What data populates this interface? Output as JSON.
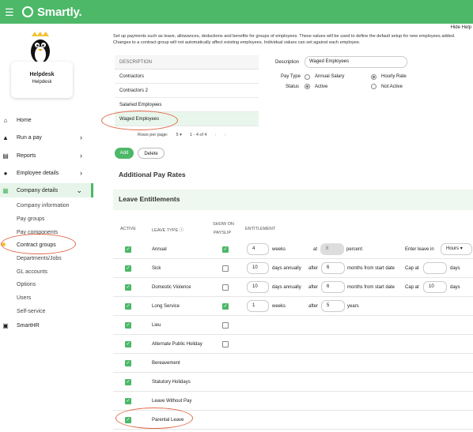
{
  "app": {
    "name": "Smartly."
  },
  "sidebar": {
    "profile": {
      "name": "Helpdesk",
      "role": "Helpdesk"
    },
    "items": [
      {
        "label": "Home",
        "icon": "home-icon"
      },
      {
        "label": "Run a pay",
        "icon": "pay-icon"
      },
      {
        "label": "Reports",
        "icon": "report-icon"
      },
      {
        "label": "Employee details",
        "icon": "person-icon"
      },
      {
        "label": "Company details",
        "icon": "building-icon"
      }
    ],
    "sub": [
      "Company information",
      "Pay groups",
      "Pay components",
      "Contract groups",
      "Departments/Jobs",
      "GL accounts",
      "Options",
      "Users",
      "Self-service"
    ],
    "smarthr": "SmartHR"
  },
  "main": {
    "hide_help": "Hide Help",
    "help_text": "Set up payments such as leave, allowances, deductions and benefits for groups of employees. These values will be used to define the default setup for new employees added. Changes to a contract group will not automatically affect existing employees. Individual values can set against each employee.",
    "table": {
      "header": "DESCRIPTION",
      "rows": [
        "Contractors",
        "Contractors 2",
        "Salaried Employees",
        "Waged Employees"
      ]
    },
    "pagination": {
      "rows_label": "Rows per page:",
      "rows_value": "5",
      "range": "1 - 4 of 4"
    },
    "buttons": {
      "add": "Add",
      "delete": "Delete"
    },
    "form": {
      "description_label": "Description",
      "description_value": "Waged Employees",
      "pay_type_label": "Pay Type",
      "annual_salary": "Annual Salary",
      "hourly_rate": "Hourly Rate",
      "status_label": "Status",
      "active": "Active",
      "not_active": "Not Active"
    },
    "additional_pay_rates": "Additional Pay Rates",
    "leave_entitlements": "Leave Entitlements",
    "leave_columns": {
      "active": "ACTIVE",
      "leave_type": "LEAVE TYPE",
      "show_on": "SHOW ON",
      "payslip": "PAYSLIP",
      "entitlement": "ENTITLEMENT"
    },
    "leave_rows": [
      {
        "name": "Annual",
        "active": true,
        "payslip": true,
        "value": "4",
        "unit": "weeks",
        "at": "at",
        "pct": "8",
        "pct_label": "percent",
        "enter_label": "Enter leave in",
        "enter_value": "Hours"
      },
      {
        "name": "Sick",
        "active": true,
        "payslip": false,
        "value": "10",
        "unit": "days annually",
        "after": "after",
        "after_val": "6",
        "after_unit": "months from start date",
        "cap": "Cap at",
        "cap_val": "",
        "cap_unit": "days"
      },
      {
        "name": "Domestic Violence",
        "active": true,
        "payslip": false,
        "value": "10",
        "unit": "days annually",
        "after": "after",
        "after_val": "6",
        "after_unit": "months from start date",
        "cap": "Cap at",
        "cap_val": "10",
        "cap_unit": "days"
      },
      {
        "name": "Long Service",
        "active": true,
        "payslip": true,
        "value": "1",
        "unit": "weeks",
        "after": "after",
        "after_val": "5",
        "after_unit": "years"
      },
      {
        "name": "Lieu",
        "active": true,
        "payslip": false
      },
      {
        "name": "Alternate Public Holiday",
        "active": true,
        "payslip": false
      },
      {
        "name": "Bereavement",
        "active": true
      },
      {
        "name": "Statutory Holidays",
        "active": true
      },
      {
        "name": "Leave Without Pay",
        "active": true
      },
      {
        "name": "Parental Leave",
        "active": true
      }
    ]
  },
  "colors": {
    "brand": "#4cb868",
    "annotation": "#e06a4c"
  }
}
